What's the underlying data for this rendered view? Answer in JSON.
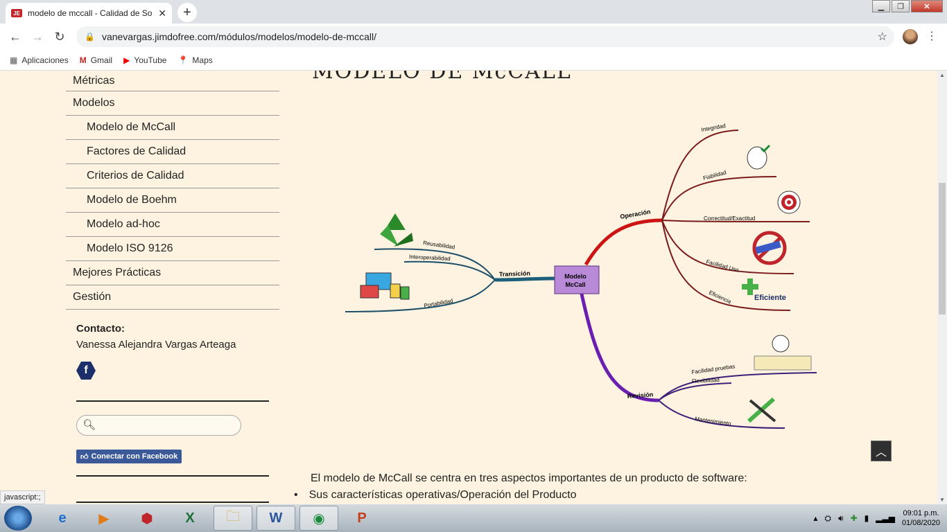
{
  "browser": {
    "tab_title": "modelo de mccall - Calidad de So",
    "tab_favicon": "JE",
    "url": "vanevargas.jimdofree.com/módulos/modelos/modelo-de-mccall/",
    "bookmarks": [
      "Aplicaciones",
      "Gmail",
      "YouTube",
      "Maps"
    ]
  },
  "sidebar": {
    "items": [
      {
        "label": "Métricas",
        "sub": false
      },
      {
        "label": "Modelos",
        "sub": false
      },
      {
        "label": "Modelo de McCall",
        "sub": true
      },
      {
        "label": "Factores de Calidad",
        "sub": true
      },
      {
        "label": "Criterios de Calidad",
        "sub": true
      },
      {
        "label": "Modelo de Boehm",
        "sub": true
      },
      {
        "label": "Modelo ad-hoc",
        "sub": true
      },
      {
        "label": "Modelo ISO 9126",
        "sub": true
      },
      {
        "label": "Mejores Prácticas",
        "sub": false
      },
      {
        "label": "Gestión",
        "sub": false
      }
    ],
    "contact_title": "Contacto:",
    "contact_name": "Vanessa Alejandra Vargas Arteaga",
    "facebook_letter": "f",
    "fb_connect": "Conectar con Facebook"
  },
  "main": {
    "heading": "MODELO DE McCALL",
    "mindmap": {
      "center": [
        "Modelo",
        "McCall"
      ],
      "branches": {
        "transicion": "Transición",
        "operacion": "Operación",
        "revision": "Revisión"
      },
      "leaves": {
        "reusabilidad": "Reusabilidad",
        "interoperabilidad": "Interoperabilidad",
        "portabilidad": "Portabilidad",
        "integridad": "Integridad",
        "fiabilidad": "Fiabilidad",
        "correctitud": "Correctitud/Exactitud",
        "facilidad_uso": "Facilidad Uso",
        "eficiencia": "Eficiencia",
        "eficiente": "Eficiente",
        "facilidad_pruebas": "Facilidad pruebas",
        "flexibilidad": "Flexibilidad",
        "mantenimiento": "Mantenimiento"
      }
    },
    "intro": "El modelo de McCall se centra en tres aspectos importantes de un producto de software:",
    "bullet": "Sus características operativas/Operación del Producto"
  },
  "status_text": "javascript:;",
  "taskbar": {
    "time": "09:01 p.m.",
    "date": "01/08/2020"
  },
  "colors": {
    "page_bg": "#fdf3e0",
    "operacion": "#cc1414",
    "revision": "#6a1fb0",
    "transicion": "#1d5f7a",
    "leaf_op": "#7a1a1a",
    "leaf_rev": "#3d1f7a",
    "leaf_tr": "#1d4f6a"
  }
}
